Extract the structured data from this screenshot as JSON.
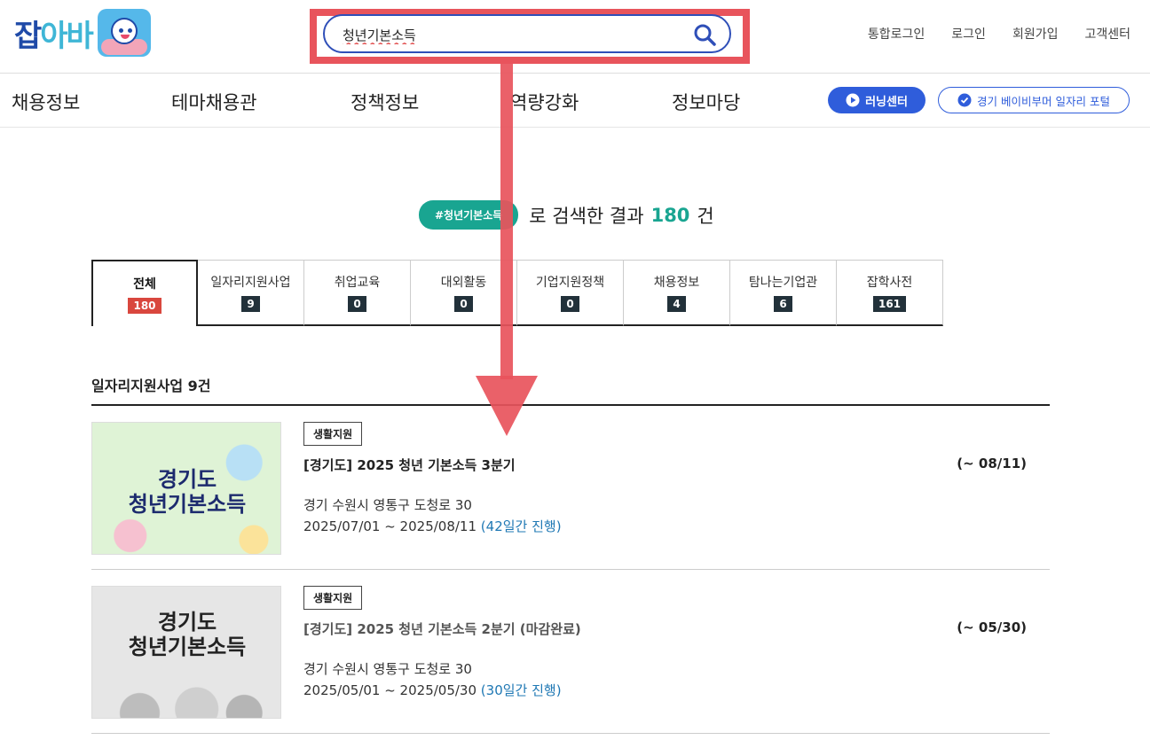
{
  "header": {
    "logo_part1": "잡",
    "logo_part2": "아바",
    "search_value": "청년기본소득",
    "links": [
      "통합로그인",
      "로그인",
      "회원가입",
      "고객센터"
    ]
  },
  "nav": {
    "items": [
      "채용정보",
      "테마채용관",
      "정책정보",
      "역량강화",
      "정보마당"
    ],
    "learning_button": "러닝센터",
    "portal_button": "경기 베이비부머 일자리 포털"
  },
  "result": {
    "tag": "#청년기본소득",
    "text_before": "로 검색한 결과",
    "count": "180",
    "unit": "건"
  },
  "tabs": [
    {
      "label": "전체",
      "count": "180"
    },
    {
      "label": "일자리지원사업",
      "count": "9"
    },
    {
      "label": "취업교육",
      "count": "0"
    },
    {
      "label": "대외활동",
      "count": "0"
    },
    {
      "label": "기업지원정책",
      "count": "0"
    },
    {
      "label": "채용정보",
      "count": "4"
    },
    {
      "label": "탐나는기업관",
      "count": "6"
    },
    {
      "label": "잡학사전",
      "count": "161"
    }
  ],
  "section": {
    "title": "일자리지원사업 9건"
  },
  "items": [
    {
      "badge": "생활지원",
      "title": "[경기도] 2025 청년 기본소득 3분기",
      "deadline": "(~ 08/11)",
      "address": "경기 수원시 영통구 도청로 30",
      "period": "2025/07/01 ~ 2025/08/11",
      "duration": "(42일간 진행)",
      "thumb_line1": "경기도",
      "thumb_line2": "청년기본소득"
    },
    {
      "badge": "생활지원",
      "title": "[경기도] 2025 청년 기본소득 2분기  (마감완료)",
      "deadline": "(~ 05/30)",
      "address": "경기 수원시 영통구 도청로 30",
      "period": "2025/05/01 ~ 2025/05/30",
      "duration": "(30일간 진행)",
      "thumb_line1": "경기도",
      "thumb_line2": "청년기본소득"
    }
  ],
  "colors": {
    "brand_blue": "#2f5ddb",
    "teal": "#19a591",
    "annotation_red": "#e8545c",
    "active_count": "#d9473e"
  }
}
